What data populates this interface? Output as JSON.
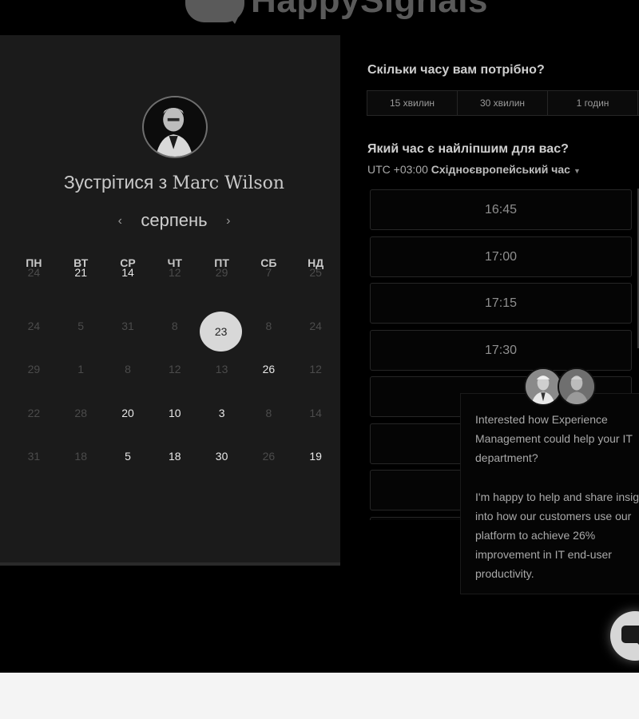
{
  "brand": {
    "logo_text": "HappySignals"
  },
  "booking": {
    "title_prefix": "Зустрітися з ",
    "host_name": "Marc Wilson",
    "month": "серпень",
    "prev_arrow": "‹",
    "next_arrow": "›",
    "weekdays": [
      "ПН",
      "ВТ",
      "СР",
      "ЧТ",
      "ПТ",
      "СБ",
      "НД"
    ],
    "weeks": [
      [
        {
          "d": "24",
          "s": "dim"
        },
        {
          "d": "21",
          "s": "avail"
        },
        {
          "d": "14",
          "s": "avail"
        },
        {
          "d": "12",
          "s": "dim"
        },
        {
          "d": "29",
          "s": "dim"
        },
        {
          "d": "7",
          "s": "dim"
        },
        {
          "d": "25",
          "s": "dim"
        }
      ],
      [
        {
          "d": "24",
          "s": "dim"
        },
        {
          "d": "5",
          "s": "dim"
        },
        {
          "d": "31",
          "s": "dim"
        },
        {
          "d": "8",
          "s": "dim"
        },
        {
          "d": "23",
          "s": "sel"
        },
        {
          "d": "8",
          "s": "dim"
        },
        {
          "d": "24",
          "s": "dim"
        }
      ],
      [
        {
          "d": "29",
          "s": "dim"
        },
        {
          "d": "1",
          "s": "dim"
        },
        {
          "d": "8",
          "s": "dim"
        },
        {
          "d": "12",
          "s": "dim"
        },
        {
          "d": "13",
          "s": "dim"
        },
        {
          "d": "26",
          "s": "avail"
        },
        {
          "d": "12",
          "s": "dim"
        }
      ],
      [
        {
          "d": "22",
          "s": "dim"
        },
        {
          "d": "28",
          "s": "dim"
        },
        {
          "d": "20",
          "s": "avail"
        },
        {
          "d": "10",
          "s": "avail"
        },
        {
          "d": "3",
          "s": "avail"
        },
        {
          "d": "8",
          "s": "dim"
        },
        {
          "d": "14",
          "s": "dim"
        }
      ],
      [
        {
          "d": "31",
          "s": "dim"
        },
        {
          "d": "18",
          "s": "dim"
        },
        {
          "d": "5",
          "s": "avail"
        },
        {
          "d": "18",
          "s": "avail"
        },
        {
          "d": "30",
          "s": "avail"
        },
        {
          "d": "26",
          "s": "dim"
        },
        {
          "d": "19",
          "s": "avail"
        }
      ]
    ]
  },
  "scheduler": {
    "duration_question": "Скільки часу вам потрібно?",
    "durations": [
      "15 хвилин",
      "30 хвилин",
      "1 годин"
    ],
    "time_question": "Який час є найліпшим для вас?",
    "timezone_offset": "UTC +03:00",
    "timezone_name": "Східноєвропейський час",
    "timezone_caret": "▼",
    "slots": [
      "16:45",
      "17:00",
      "17:15",
      "17:30",
      "",
      "",
      "",
      ""
    ]
  },
  "chat": {
    "message_1": "Interested how Experience Management could help your IT department?",
    "message_2": "I'm happy to help and share insight into how our customers use our platform to achieve 26% improvement in IT end-user productivity."
  },
  "colors": {
    "page_bg": "#000000",
    "panel_bg": "#1b1b1b",
    "selected_day": "#d8d8d8",
    "footer_bg": "#f4f4f4"
  }
}
